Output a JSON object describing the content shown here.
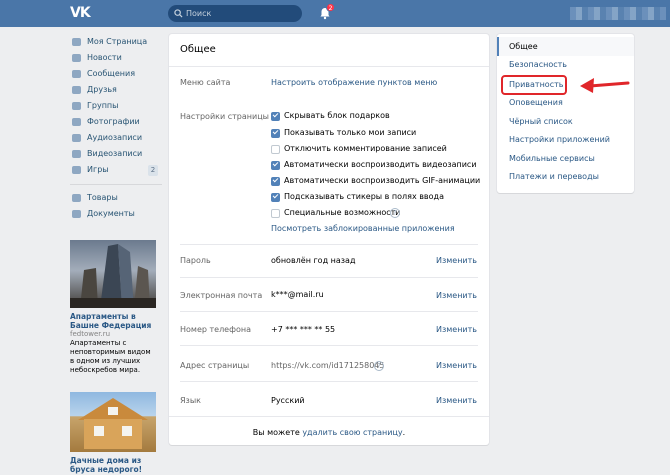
{
  "header": {
    "logo": "VK",
    "search_placeholder": "Поиск",
    "notifications_count": "2"
  },
  "left_nav": {
    "items": [
      {
        "label": "Моя Страница",
        "icon": "home-icon"
      },
      {
        "label": "Новости",
        "icon": "news-icon"
      },
      {
        "label": "Сообщения",
        "icon": "messages-icon"
      },
      {
        "label": "Друзья",
        "icon": "friends-icon"
      },
      {
        "label": "Группы",
        "icon": "groups-icon"
      },
      {
        "label": "Фотографии",
        "icon": "photos-icon"
      },
      {
        "label": "Аудиозаписи",
        "icon": "audio-icon"
      },
      {
        "label": "Видеозаписи",
        "icon": "video-icon"
      },
      {
        "label": "Игры",
        "icon": "games-icon",
        "count": "2"
      }
    ],
    "extra_items": [
      {
        "label": "Товары",
        "icon": "goods-icon"
      },
      {
        "label": "Документы",
        "icon": "documents-icon"
      }
    ]
  },
  "ads": [
    {
      "title": "Апартаменты в Башне Федерация",
      "domain": "fedtower.ru",
      "text": "Апартаменты с неповторимым видом в одном из лучших небоскребов мира."
    },
    {
      "title": "Дачные дома из бруса недорого!"
    }
  ],
  "main": {
    "title": "Общее",
    "site_menu": {
      "label": "Меню сайта",
      "link": "Настроить отображение пунктов меню"
    },
    "page_settings": {
      "label": "Настройки страницы",
      "options": [
        {
          "label": "Скрывать блок подарков",
          "checked": true
        },
        {
          "label": "Показывать только мои записи",
          "checked": true
        },
        {
          "label": "Отключить комментирование записей",
          "checked": false
        },
        {
          "label": "Автоматически воспроизводить видеозаписи",
          "checked": true
        },
        {
          "label": "Автоматически воспроизводить GIF-анимации",
          "checked": true
        },
        {
          "label": "Подсказывать стикеры в полях ввода",
          "checked": true
        },
        {
          "label": "Специальные возможности",
          "checked": false
        }
      ],
      "help_glyph": "?",
      "blocked_apps_link": "Посмотреть заблокированные приложения"
    },
    "password": {
      "label": "Пароль",
      "value": "обновлён год назад",
      "edit": "Изменить"
    },
    "email": {
      "label": "Электронная почта",
      "value": "k***@mail.ru",
      "edit": "Изменить"
    },
    "phone": {
      "label": "Номер телефона",
      "value": "+7 *** *** ** 55",
      "edit": "Изменить"
    },
    "address": {
      "label": "Адрес страницы",
      "value": "https://vk.com/id171258045",
      "edit": "Изменить"
    },
    "language": {
      "label": "Язык",
      "value": "Русский",
      "edit": "Изменить"
    },
    "footer": {
      "prefix": "Вы можете ",
      "link": "удалить свою страницу",
      "suffix": "."
    }
  },
  "right_menu": {
    "items": [
      {
        "label": "Общее",
        "active": true
      },
      {
        "label": "Безопасность"
      },
      {
        "label": "Приватность",
        "highlighted": true
      },
      {
        "label": "Оповещения"
      },
      {
        "label": "Чёрный список"
      },
      {
        "label": "Настройки приложений"
      },
      {
        "label": "Мобильные сервисы"
      },
      {
        "label": "Платежи и переводы"
      }
    ]
  },
  "colors": {
    "header": "#4a76a8",
    "link": "#2a5885",
    "checkbox": "#5181b8",
    "annotation": "#e0262a"
  }
}
